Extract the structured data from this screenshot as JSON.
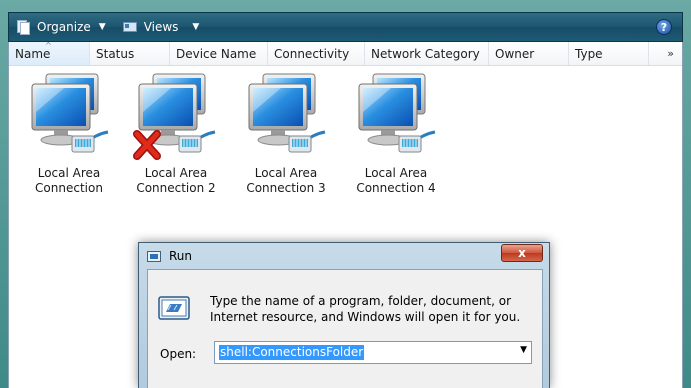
{
  "toolbar": {
    "organize_label": "Organize",
    "views_label": "Views",
    "help_glyph": "?"
  },
  "columns": [
    "Name",
    "Status",
    "Device Name",
    "Connectivity",
    "Network Category",
    "Owner",
    "Type"
  ],
  "more_columns_glyph": "»",
  "sort_glyph": "^",
  "connections": [
    {
      "line1": "Local Area",
      "line2": "Connection",
      "status": "enabled"
    },
    {
      "line1": "Local Area",
      "line2": "Connection 2",
      "status": "disabled"
    },
    {
      "line1": "Local Area",
      "line2": "Connection 3",
      "status": "enabled"
    },
    {
      "line1": "Local Area",
      "line2": "Connection 4",
      "status": "enabled"
    }
  ],
  "run_dialog": {
    "title": "Run",
    "close_glyph": "x",
    "message": "Type the name of a program, folder, document, or Internet resource, and Windows will open it for you.",
    "open_label": "Open:",
    "open_value": "shell:ConnectionsFolder",
    "dropdown_glyph": "▼"
  },
  "colors": {
    "accent": "#1d5570",
    "selection": "#3399ff",
    "close_button": "#d0553a",
    "disabled_x": "#d8261a"
  }
}
